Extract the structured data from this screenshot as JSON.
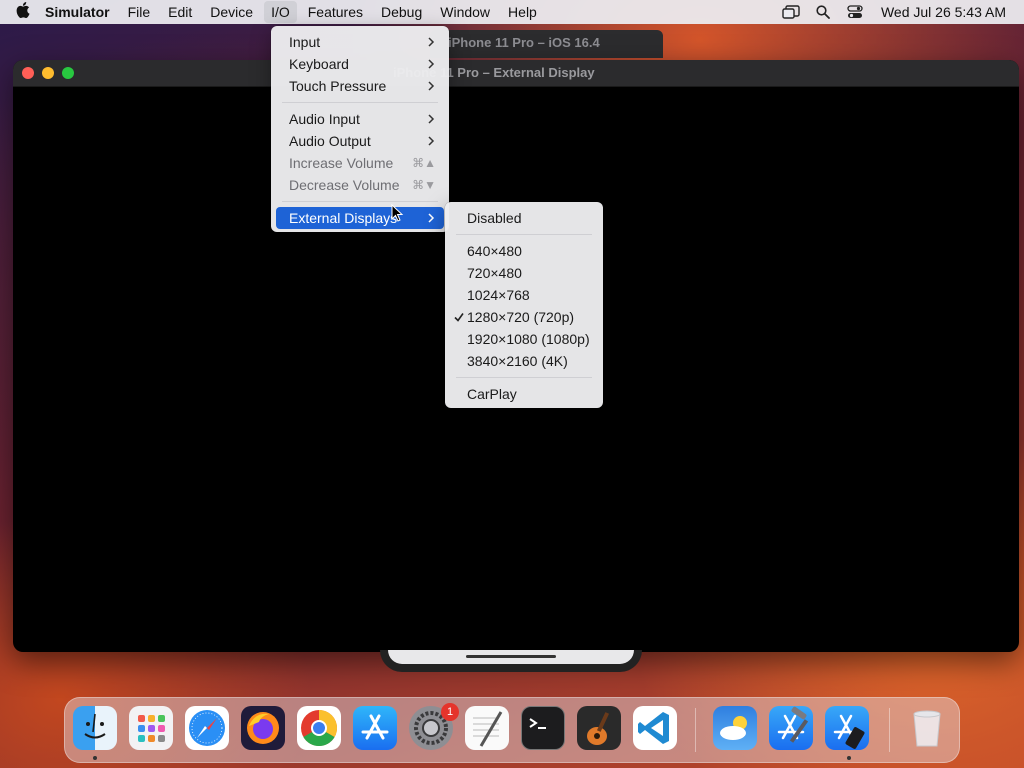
{
  "menubar": {
    "app_name": "Simulator",
    "menus": [
      "File",
      "Edit",
      "Device",
      "I/O",
      "Features",
      "Debug",
      "Window",
      "Help"
    ],
    "active_menu": "I/O",
    "clock": "Wed Jul 26  5:43 AM",
    "status_icons": [
      "stage-manager-icon",
      "spotlight-search-icon",
      "control-center-icon"
    ]
  },
  "background_window": {
    "title": "iPhone 11 Pro – iOS 16.4"
  },
  "window": {
    "title": "iPhone 11 Pro – External Display"
  },
  "io_menu": {
    "items": [
      {
        "label": "Input",
        "submenu": true
      },
      {
        "label": "Keyboard",
        "submenu": true
      },
      {
        "label": "Touch Pressure",
        "submenu": true
      },
      {
        "label": "Audio Input",
        "submenu": true
      },
      {
        "label": "Audio Output",
        "submenu": true
      },
      {
        "label": "Increase Volume",
        "shortcut": "⌘▲"
      },
      {
        "label": "Decrease Volume",
        "shortcut": "⌘▼"
      },
      {
        "label": "External Displays",
        "submenu": true,
        "highlighted": true
      }
    ]
  },
  "external_displays_menu": {
    "items": [
      {
        "label": "Disabled"
      },
      {
        "label": "640×480"
      },
      {
        "label": "720×480"
      },
      {
        "label": "1024×768"
      },
      {
        "label": "1280×720 (720p)",
        "checked": true
      },
      {
        "label": "1920×1080 (1080p)"
      },
      {
        "label": "3840×2160 (4K)"
      },
      {
        "label": "CarPlay"
      }
    ]
  },
  "dock": {
    "apps": [
      "Finder",
      "Launchpad",
      "Safari",
      "Firefox",
      "Chrome",
      "App Store",
      "System Settings",
      "TextEdit",
      "Terminal",
      "GarageBand",
      "Visual Studio Code",
      "Weather",
      "Xcode",
      "Simulator",
      "Trash"
    ],
    "system_settings_badge": "1"
  },
  "colors": {
    "menu_highlight": "#1e63d6",
    "traffic_red": "#ff5f57",
    "traffic_yellow": "#febc2e",
    "traffic_green": "#28c840"
  }
}
